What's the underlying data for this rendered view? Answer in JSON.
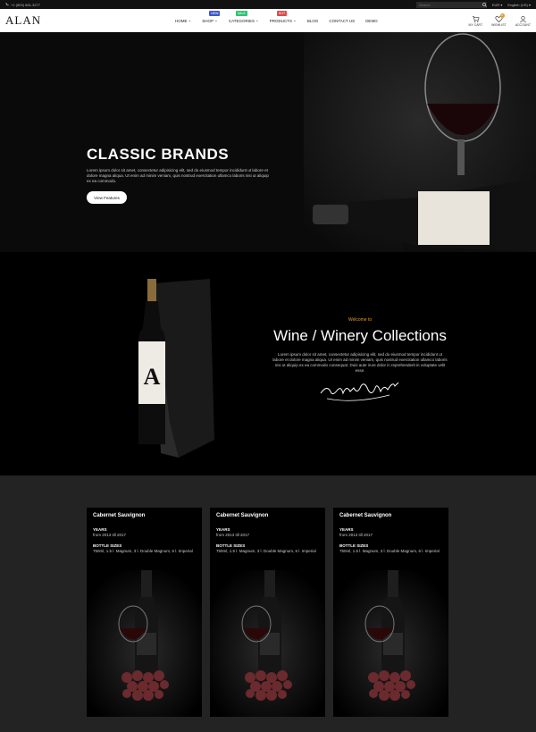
{
  "topbar": {
    "phone": "+1 (800) 681-3277",
    "search_placeholder": "Search...",
    "currency": "EUR",
    "language": "English (US)"
  },
  "nav": {
    "logo": "ALAN",
    "items": [
      {
        "label": "HOME",
        "has_caret": true,
        "badge": ""
      },
      {
        "label": "SHOP",
        "has_caret": true,
        "badge": "NEW",
        "badge_color": "#3b57d6"
      },
      {
        "label": "CATEGORIES",
        "has_caret": true,
        "badge": "SALE",
        "badge_color": "#28c76f"
      },
      {
        "label": "PRODUCTS",
        "has_caret": true,
        "badge": "HOT",
        "badge_color": "#e84545"
      },
      {
        "label": "BLOG",
        "has_caret": false,
        "badge": ""
      },
      {
        "label": "CONTACT US",
        "has_caret": false,
        "badge": ""
      },
      {
        "label": "DEMO",
        "has_caret": false,
        "badge": ""
      }
    ],
    "cart_label": "MY CART",
    "wishlist_label": "WISHLIST",
    "wishlist_count": "0",
    "account_label": "ACCOUNT"
  },
  "hero": {
    "title": "CLASSIC BRANDS",
    "text": "Lorem ipsum dolor sit amet, consectetur adipisicing elit, sed do eiusmod tempor incididunt ut labore et dolore magna aliqua. Ut enim ad minim veniam, quis nostrud exercitation ullamco laboris nisi ut aliquip ex ea commodo.",
    "button": "View Features"
  },
  "collection": {
    "pretitle": "Welcome to",
    "title": "Wine / Winery Collections",
    "text": "Lorem ipsum dolor sit amet, consectetur adipisicing elit, sed do eiusmod tempor incididunt ut labore et dolore magna aliqua. Ut enim ad minim veniam, quis nostrud exercitation ullamco laboris nisi ut aliquip ex ea commodo consequat. Duis aute irure dolor in reprehenderit in voluptate velit esse.",
    "bottle_letter": "A"
  },
  "products": [
    {
      "name": "Cabernet Sauvignon",
      "years_label": "YEARS",
      "years": "from 2013 till 2017",
      "sizes_label": "BOTTLE SIZES",
      "sizes": "750ml, 1.5 l. Magnum, 3 l. Double Magnum, 6 l. Imperial"
    },
    {
      "name": "Cabernet Sauvignon",
      "years_label": "YEARS",
      "years": "from 2013 till 2017",
      "sizes_label": "BOTTLE SIZES",
      "sizes": "750ml, 1.5 l. Magnum, 3 l. Double Magnum, 6 l. Imperial"
    },
    {
      "name": "Cabernet Sauvignon",
      "years_label": "YEARS",
      "years": "from 2013 till 2017",
      "sizes_label": "BOTTLE SIZES",
      "sizes": "750ml, 1.5 l. Magnum, 3 l. Double Magnum, 6 l. Imperial"
    }
  ],
  "colors": {
    "accent": "#e09c2d",
    "dark": "#000000",
    "section": "#232323"
  }
}
